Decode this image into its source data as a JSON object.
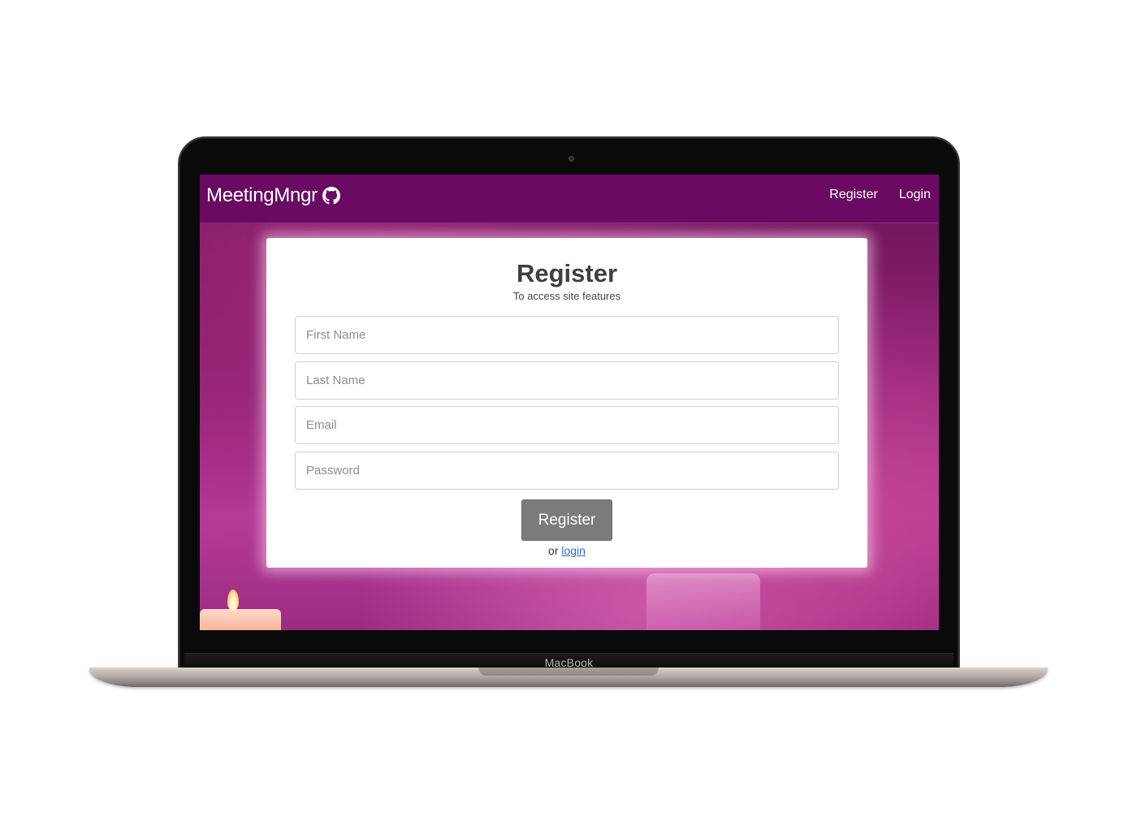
{
  "device": {
    "label": "MacBook"
  },
  "navbar": {
    "brand": "MeetingMngr",
    "brand_icon": "github-icon",
    "links": [
      {
        "label": "Register"
      },
      {
        "label": "Login"
      }
    ],
    "background_color": "#6a0a62"
  },
  "form": {
    "title": "Register",
    "subtitle": "To access site features",
    "fields": [
      {
        "placeholder": "First Name",
        "value": ""
      },
      {
        "placeholder": "Last Name",
        "value": ""
      },
      {
        "placeholder": "Email",
        "value": ""
      },
      {
        "placeholder": "Password",
        "value": ""
      }
    ],
    "submit_label": "Register",
    "alt_prefix": "or",
    "alt_link": "login",
    "button_color": "#7b7b7b",
    "link_color": "#2a6bcf"
  }
}
